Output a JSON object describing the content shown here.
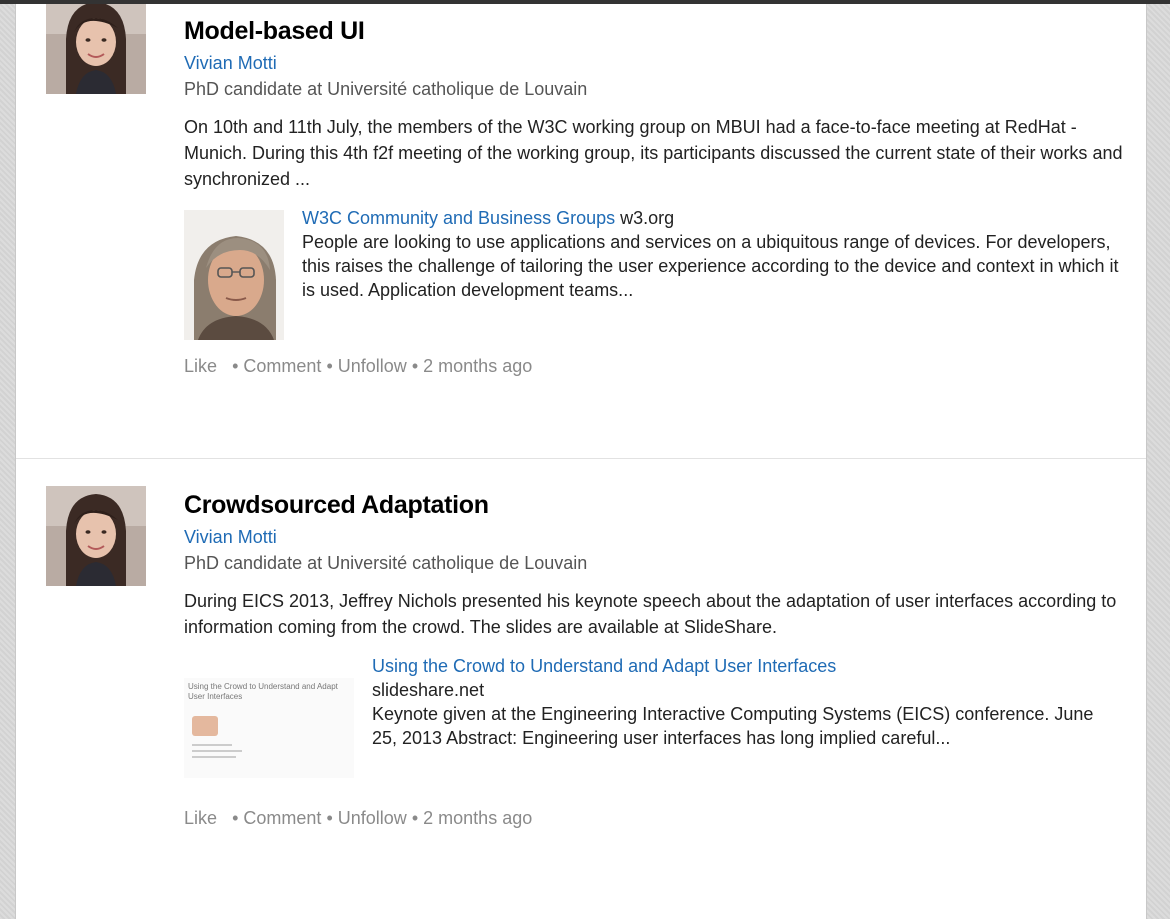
{
  "posts": [
    {
      "title": "Model-based UI",
      "author": "Vivian Motti",
      "headline": "PhD candidate at Université catholique de Louvain",
      "body": "On 10th and 11th July, the members of the W3C working group on MBUI had a face-to-face meeting at RedHat - Munich. During this 4th f2f meeting of the working group, its participants discussed the current state of their works and synchronized ...",
      "attachment": {
        "title": "W3C Community and Business Groups",
        "source": "w3.org",
        "description": "People are looking to use applications and services on a ubiquitous range of devices. For developers, this raises the challenge of tailoring the user experience according to the device and context in which it is used. Application development teams..."
      },
      "actions": {
        "like": "Like",
        "comment": "Comment",
        "unfollow": "Unfollow",
        "time": "2 months ago",
        "separator": "•"
      }
    },
    {
      "title": "Crowdsourced Adaptation",
      "author": "Vivian Motti",
      "headline": "PhD candidate at Université catholique de Louvain",
      "body": "During EICS 2013, Jeffrey Nichols presented his keynote speech about the adaptation of user interfaces according to information coming from the crowd. The slides are available at SlideShare.",
      "attachment": {
        "title": "Using the Crowd to Understand and Adapt User Interfaces",
        "source": "slideshare.net",
        "description": "Keynote given at the Engineering Interactive Computing Systems (EICS) conference. June 25, 2013 Abstract: Engineering user interfaces has long implied careful...",
        "thumb_title": "Using the Crowd to Understand and Adapt User Interfaces"
      },
      "actions": {
        "like": "Like",
        "comment": "Comment",
        "unfollow": "Unfollow",
        "time": "2 months ago",
        "separator": "•"
      }
    }
  ],
  "colors": {
    "link": "#1f6bb5",
    "muted": "#8a8a8a",
    "headline": "#555555"
  }
}
